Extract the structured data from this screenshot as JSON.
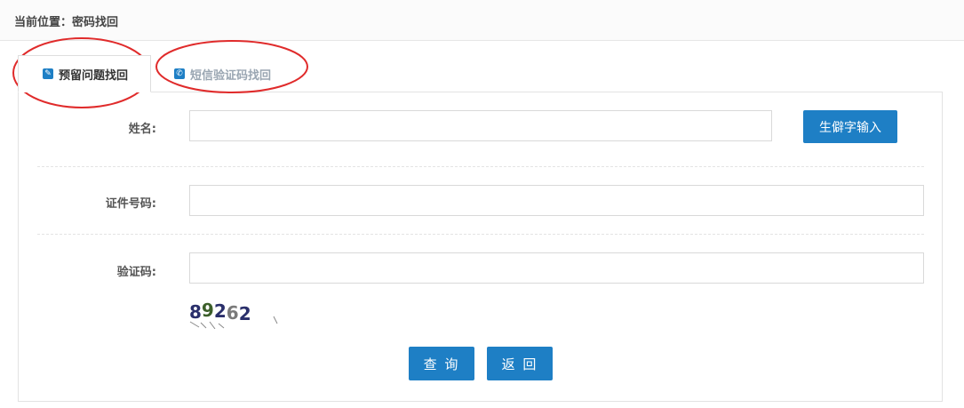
{
  "breadcrumb": "当前位置：密码找回",
  "tabs": [
    {
      "label": "预留问题找回",
      "icon": "pencil-icon",
      "active": true
    },
    {
      "label": "短信验证码找回",
      "icon": "phone-icon",
      "active": false
    }
  ],
  "form": {
    "name_label": "姓名:",
    "name_value": "",
    "rare_char_button": "生僻字输入",
    "id_label": "证件号码:",
    "id_value": "",
    "captcha_label": "验证码:",
    "captcha_value": "",
    "captcha_text": "89262"
  },
  "actions": {
    "query_label": "查 询",
    "back_label": "返 回"
  },
  "colors": {
    "accent": "#1e7fc5",
    "highlight_circle": "#e02b2b"
  }
}
